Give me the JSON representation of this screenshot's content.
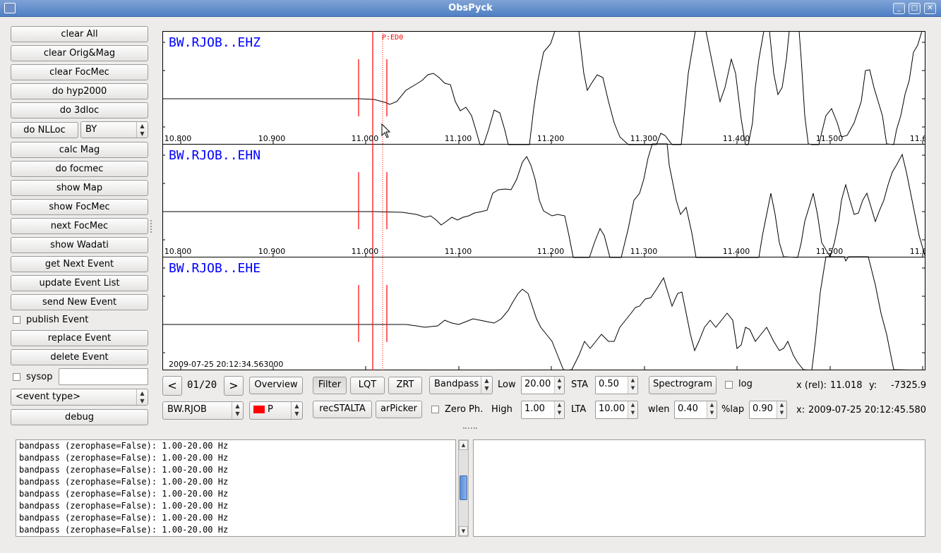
{
  "window": {
    "title": "ObsPyck",
    "buttons": [
      "_",
      "□",
      "✕"
    ]
  },
  "sidebar": {
    "buttons": {
      "clear_all": "clear All",
      "clear_orig_mag": "clear Orig&Mag",
      "clear_focmec": "clear FocMec",
      "do_hyp2000": "do hyp2000",
      "do_3dloc": "do 3dloc",
      "do_nlloc": "do NLLoc",
      "calc_mag": "calc Mag",
      "do_focmec": "do focmec",
      "show_map": "show Map",
      "show_focmec": "show FocMec",
      "next_focmec": "next FocMec",
      "show_wadati": "show Wadati",
      "get_next_event": "get Next Event",
      "update_event_list": "update Event List",
      "send_new_event": "send New Event",
      "replace_event": "replace Event",
      "delete_event": "delete Event",
      "debug": "debug"
    },
    "nlloc_region": "BY",
    "publish_event_label": "publish Event",
    "sysop_label": "sysop",
    "sysop_value": "",
    "event_type": "<event type>"
  },
  "plot": {
    "marker_label": "P:ED0",
    "datetime_label": "2009-07-25  20:12:34.563000",
    "x_ticks": [
      "10.800",
      "10.900",
      "11.000",
      "11.100",
      "11.200",
      "11.300",
      "11.400",
      "11.500",
      "11.6"
    ],
    "traces": [
      {
        "name": "BW.RJOB..EHZ"
      },
      {
        "name": "BW.RJOB..EHN"
      },
      {
        "name": "BW.RJOB..EHE"
      }
    ],
    "colors": {
      "trace": "#000000",
      "pick": "#ff0000",
      "station_label": "#0000ff"
    }
  },
  "toolbar": {
    "page": "01/20",
    "prev": "<",
    "next": ">",
    "overview": "Overview",
    "filter": "Filter",
    "lqt": "LQT",
    "zrt": "ZRT",
    "filter_type": "Bandpass",
    "low_label": "Low",
    "low_value": "20.00",
    "high_label": "High",
    "high_value": "1.00",
    "sta_label": "STA",
    "sta_value": "0.50",
    "lta_label": "LTA",
    "lta_value": "10.00",
    "spectrogram": "Spectrogram",
    "log_label": "log",
    "wlen_label": "wlen",
    "wlen_value": "0.40",
    "overlap_label": "%lap",
    "overlap_value": "0.90",
    "station": "BW.RJOB",
    "phase": "P",
    "rec_stalta": "recSTALTA",
    "ar_picker": "arPicker",
    "zero_phase_label": "Zero Ph.",
    "x_rel_label": "x (rel):",
    "x_rel_value": "11.018",
    "y_label": "y:",
    "y_value": "-7325.9",
    "x_abs_label": "x:",
    "x_abs_value": "2009-07-25  20:12:45.580"
  },
  "log": {
    "lines": [
      "bandpass (zerophase=False): 1.00-20.00 Hz",
      "bandpass (zerophase=False): 1.00-20.00 Hz",
      "bandpass (zerophase=False): 1.00-20.00 Hz",
      "bandpass (zerophase=False): 1.00-20.00 Hz",
      "bandpass (zerophase=False): 1.00-20.00 Hz",
      "bandpass (zerophase=False): 1.00-20.00 Hz",
      "bandpass (zerophase=False): 1.00-20.00 Hz",
      "bandpass (zerophase=False): 1.00-20.00 Hz"
    ]
  }
}
